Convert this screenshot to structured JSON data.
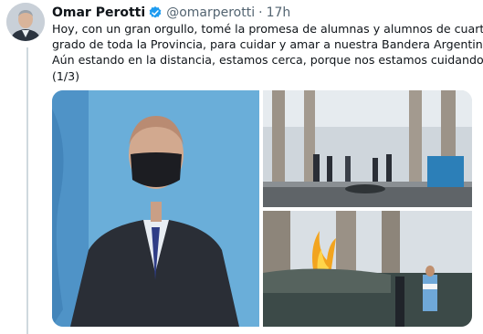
{
  "tweet": {
    "author_name": "Omar Perotti",
    "handle": "@omarperotti",
    "separator": "·",
    "time": "17h",
    "text_lines": [
      "Hoy, con un gran orgullo, tomé la promesa de alumnas y alumnos de cuarto",
      "grado de toda la Provincia, para cuidar y amar a nuestra Bandera Argentina.",
      "Aún estando en la distancia, estamos cerca, porque nos estamos cuidando.",
      "(1/3)"
    ]
  },
  "icons": {
    "verified": "verified-badge-icon",
    "avatar": "profile-avatar"
  },
  "colors": {
    "verified": "#1d9bf0",
    "muted_text": "#536471",
    "thread_line": "#cfd9de"
  }
}
